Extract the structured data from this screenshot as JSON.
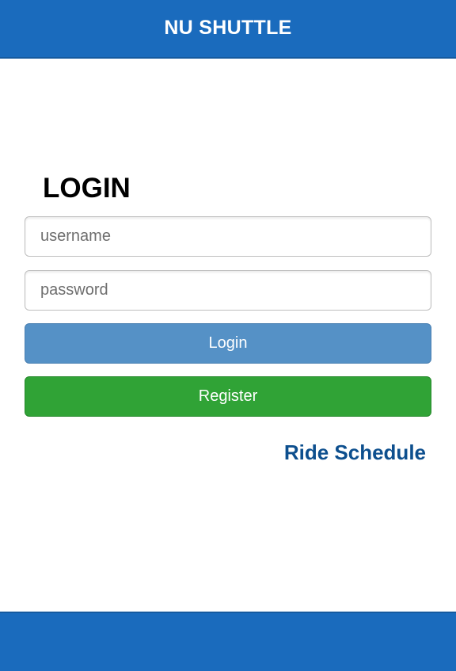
{
  "header": {
    "title": "NU SHUTTLE"
  },
  "login": {
    "heading": "LOGIN",
    "username_placeholder": "username",
    "password_placeholder": "password",
    "login_button": "Login",
    "register_button": "Register",
    "ride_schedule_link": "Ride Schedule"
  },
  "colors": {
    "brand_blue": "#1a6bbd",
    "login_button": "#5591c6",
    "register_button": "#30a336",
    "link": "#0d4f8e"
  }
}
